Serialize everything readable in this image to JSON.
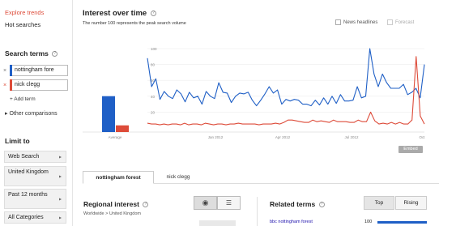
{
  "sidebar": {
    "explore_link": "Explore trends",
    "hot_link": "Hot searches",
    "search_terms_title": "Search terms",
    "terms": [
      {
        "label": "nottingham fore",
        "color": "#1f5fc6"
      },
      {
        "label": "nick clegg",
        "color": "#dd4b39"
      }
    ],
    "add_term": "+ Add term",
    "other_comparisons": "Other comparisons",
    "limit_title": "Limit to",
    "filters": [
      "Web Search",
      "United Kingdom",
      "Past 12 months",
      "All Categories"
    ]
  },
  "main": {
    "title": "Interest over time",
    "subtitle": "The number 100 represents the peak search volume",
    "news_headlines": "News headlines",
    "forecast": "Forecast",
    "embed_button": "Embed"
  },
  "chart_data": {
    "type": "line",
    "y_ticks": [
      "100",
      "80",
      "60",
      "40",
      "20"
    ],
    "ylim": [
      0,
      100
    ],
    "x_tick_labels": [
      "Average",
      "Jan 2012",
      "Apr 2012",
      "Jul 2012",
      "Oct"
    ],
    "averages": [
      {
        "name": "nottingham forest",
        "value": 43
      },
      {
        "name": "nick clegg",
        "value": 8
      }
    ],
    "series": [
      {
        "name": "nottingham forest",
        "color": "#1f5fc6",
        "values": [
          88,
          52,
          62,
          36,
          46,
          40,
          37,
          48,
          43,
          33,
          45,
          38,
          40,
          30,
          46,
          40,
          37,
          57,
          45,
          44,
          32,
          40,
          44,
          43,
          45,
          35,
          28,
          35,
          43,
          52,
          44,
          48,
          30,
          36,
          34,
          36,
          35,
          30,
          30,
          28,
          35,
          29,
          38,
          30,
          40,
          31,
          42,
          34,
          34,
          35,
          52,
          38,
          40,
          100,
          68,
          52,
          68,
          57,
          50,
          50,
          50,
          55,
          42,
          45,
          50,
          38,
          80
        ]
      },
      {
        "name": "nick clegg",
        "color": "#dd4b39",
        "values": [
          6,
          5,
          5,
          4,
          5,
          4,
          5,
          5,
          4,
          6,
          4,
          5,
          5,
          4,
          6,
          5,
          4,
          5,
          5,
          4,
          5,
          5,
          6,
          5,
          5,
          5,
          5,
          4,
          5,
          5,
          5,
          6,
          5,
          7,
          10,
          10,
          9,
          8,
          7,
          7,
          10,
          8,
          9,
          8,
          7,
          10,
          8,
          8,
          8,
          7,
          7,
          10,
          8,
          8,
          20,
          9,
          5,
          6,
          5,
          7,
          5,
          7,
          5,
          5,
          10,
          90,
          15,
          5
        ]
      }
    ]
  },
  "tabs": [
    "nottingham forest",
    "nick clegg"
  ],
  "regional": {
    "title": "Regional interest",
    "breadcrumb": "Worldwide > United Kingdom"
  },
  "related": {
    "title": "Related terms",
    "top": "Top",
    "rising": "Rising",
    "first_term": "bbc nottingham forest",
    "first_value": "100"
  }
}
